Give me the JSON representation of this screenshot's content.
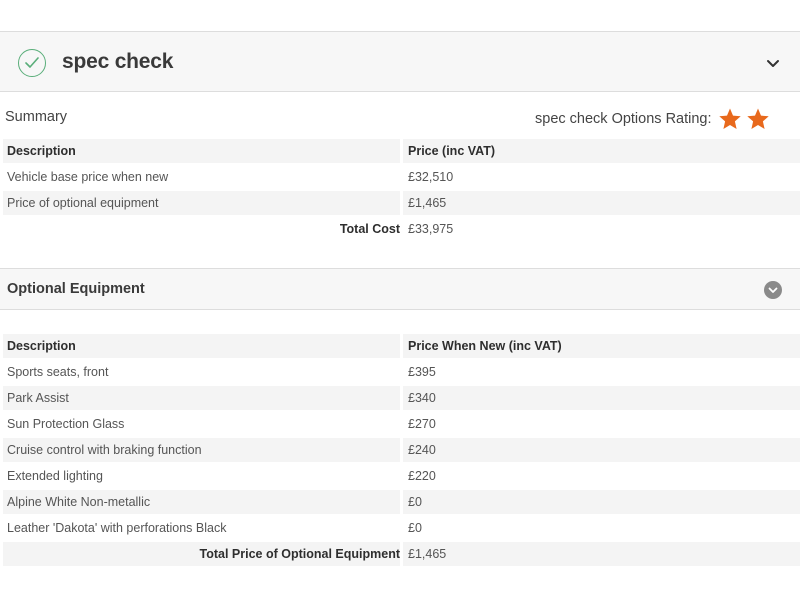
{
  "spec_header": {
    "title": "spec check",
    "icon": "check-icon",
    "toggle_icon": "chevron-down-icon"
  },
  "summary": {
    "label": "Summary",
    "rating_label": "spec check Options Rating:",
    "rating_stars": 2,
    "star_color": "#e8691c",
    "columns": [
      "Description",
      "Price (inc VAT)"
    ],
    "rows": [
      {
        "description": "Vehicle base price when new",
        "price": "£32,510"
      },
      {
        "description": "Price of optional equipment",
        "price": "£1,465"
      }
    ],
    "total_label": "Total Cost",
    "total_value": "£33,975"
  },
  "optional_equipment": {
    "title": "Optional Equipment",
    "toggle_icon": "chevron-down-circle-icon",
    "columns": [
      "Description",
      "Price When New (inc VAT)"
    ],
    "rows": [
      {
        "description": "Sports seats, front",
        "price": "£395"
      },
      {
        "description": "Park Assist",
        "price": "£340"
      },
      {
        "description": "Sun Protection Glass",
        "price": "£270"
      },
      {
        "description": "Cruise control with braking function",
        "price": "£240"
      },
      {
        "description": "Extended lighting",
        "price": "£220"
      },
      {
        "description": "Alpine White Non-metallic",
        "price": "£0"
      },
      {
        "description": "Leather 'Dakota' with perforations Black",
        "price": "£0"
      }
    ],
    "total_label": "Total Price of Optional Equipment",
    "total_value": "£1,465"
  }
}
